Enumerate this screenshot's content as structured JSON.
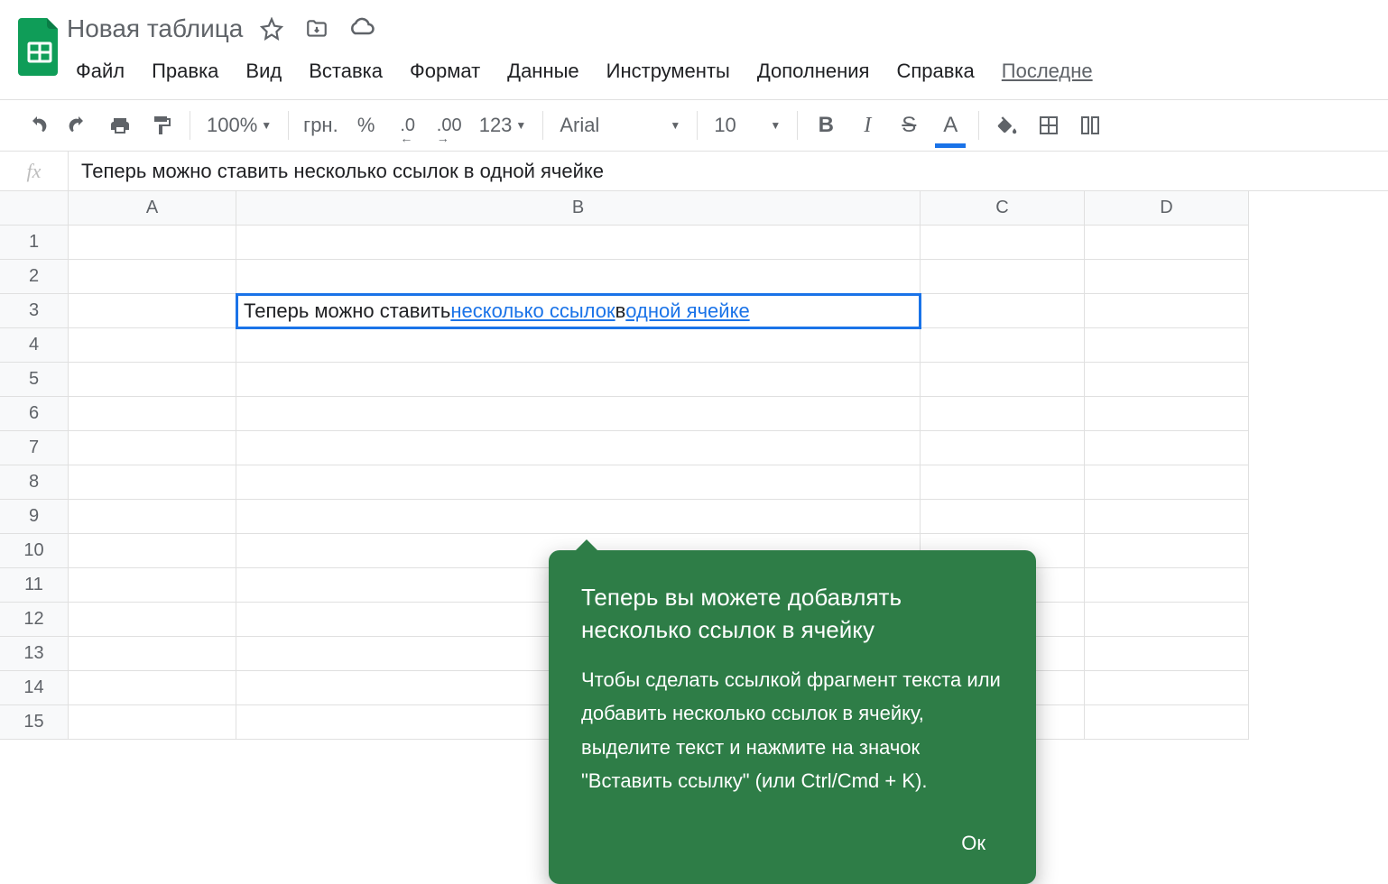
{
  "doc": {
    "title": "Новая таблица"
  },
  "menu": {
    "file": "Файл",
    "edit": "Правка",
    "view": "Вид",
    "insert": "Вставка",
    "format": "Формат",
    "data": "Данные",
    "tools": "Инструменты",
    "addons": "Дополнения",
    "help": "Справка",
    "last": "Последне"
  },
  "toolbar": {
    "zoom": "100%",
    "currency": "грн.",
    "percent": "%",
    "dec_minus": ".0",
    "dec_plus": ".00",
    "num_format": "123",
    "font": "Arial",
    "size": "10"
  },
  "fx": {
    "label": "fx",
    "value": "Теперь можно ставить несколько ссылок в одной ячейке"
  },
  "columns": {
    "a": "A",
    "b": "B",
    "c": "C",
    "d": "D"
  },
  "rows": [
    "1",
    "2",
    "3",
    "4",
    "5",
    "6",
    "7",
    "8",
    "9",
    "10",
    "11",
    "12",
    "13",
    "14",
    "15"
  ],
  "cell_b3": {
    "parts": [
      {
        "text": "Теперь можно ставить ",
        "link": false
      },
      {
        "text": "несколько ссылок",
        "link": true
      },
      {
        "text": " в ",
        "link": false
      },
      {
        "text": "одной ячейке",
        "link": true
      }
    ]
  },
  "popover": {
    "title": "Теперь вы можете добавлять несколько ссылок в ячейку",
    "body": "Чтобы сделать ссылкой фрагмент текста или добавить несколько ссылок в ячейку, выделите текст и нажмите на значок \"Вставить ссылку\" (или Ctrl/Cmd + K).",
    "ok": "Ок"
  }
}
